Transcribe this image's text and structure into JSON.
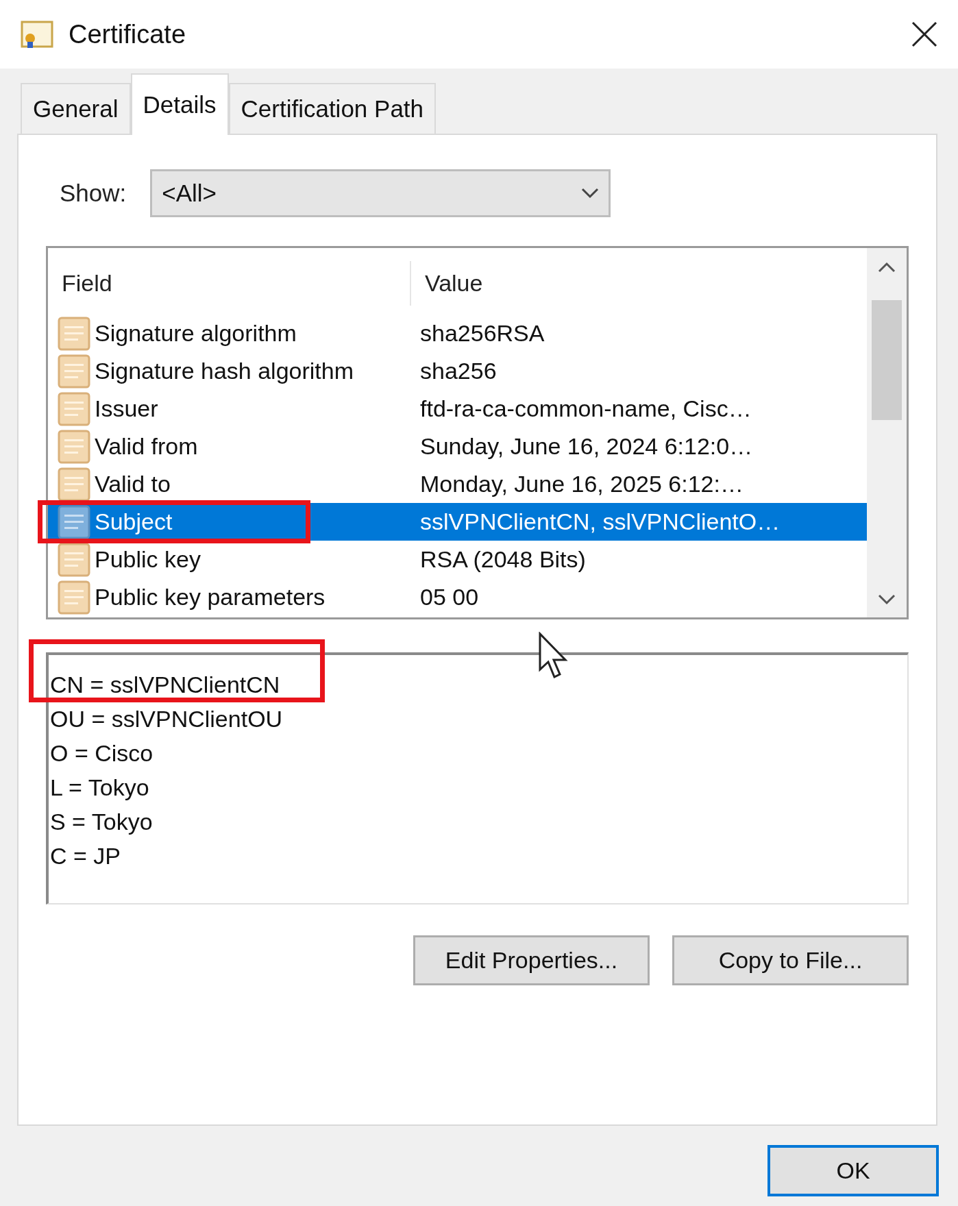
{
  "window": {
    "title": "Certificate"
  },
  "tabs": [
    {
      "label": "General",
      "selected": false
    },
    {
      "label": "Details",
      "selected": true
    },
    {
      "label": "Certification Path",
      "selected": false
    }
  ],
  "show": {
    "label": "Show:",
    "value": "<All>"
  },
  "fields": {
    "columns": [
      "Field",
      "Value"
    ],
    "rows": [
      {
        "field": "Signature algorithm",
        "value": "sha256RSA",
        "selected": false
      },
      {
        "field": "Signature hash algorithm",
        "value": "sha256",
        "selected": false
      },
      {
        "field": "Issuer",
        "value": "ftd-ra-ca-common-name, Cisc…",
        "selected": false
      },
      {
        "field": "Valid from",
        "value": "Sunday, June 16, 2024 6:12:0…",
        "selected": false
      },
      {
        "field": "Valid to",
        "value": "Monday, June 16, 2025 6:12:…",
        "selected": false
      },
      {
        "field": "Subject",
        "value": "sslVPNClientCN, sslVPNClientO…",
        "selected": true
      },
      {
        "field": "Public key",
        "value": "RSA (2048 Bits)",
        "selected": false
      },
      {
        "field": "Public key parameters",
        "value": "05 00",
        "selected": false
      }
    ]
  },
  "detail_lines": [
    "CN = sslVPNClientCN",
    "OU = sslVPNClientOU",
    "O = Cisco",
    "L = Tokyo",
    "S = Tokyo",
    "C = JP"
  ],
  "buttons": [
    "Edit Properties...",
    "Copy to File..."
  ],
  "ok_button": "OK"
}
